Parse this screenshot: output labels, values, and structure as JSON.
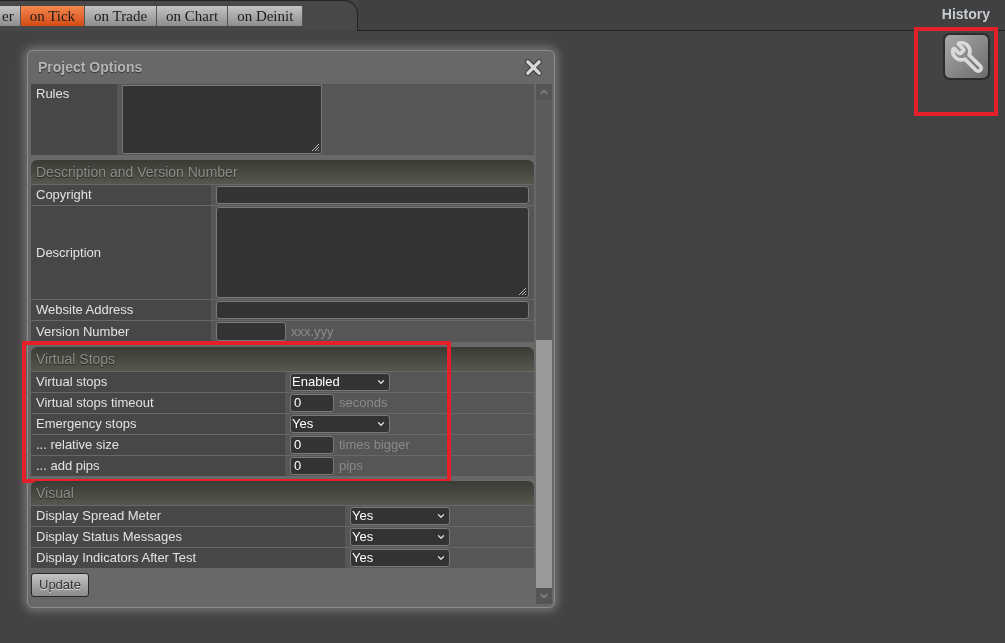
{
  "tabs": [
    {
      "label": "er",
      "selected": false
    },
    {
      "label": "on Tick",
      "selected": true
    },
    {
      "label": "on Trade",
      "selected": false
    },
    {
      "label": "on Chart",
      "selected": false
    },
    {
      "label": "on Deinit",
      "selected": false
    }
  ],
  "history": {
    "label": "History",
    "tool_highlighted": true
  },
  "dialog": {
    "title": "Project Options",
    "sections": [
      {
        "highlighted": false,
        "rows": [
          {
            "label": "Rules",
            "kind": "short_textarea"
          }
        ]
      },
      {
        "title": "Description and Version Number",
        "highlighted": false,
        "rows": [
          {
            "label": "Copyright",
            "kind": "input"
          },
          {
            "label": "Description",
            "kind": "textarea"
          },
          {
            "label": "Website Address",
            "kind": "input"
          },
          {
            "label": "Version Number",
            "kind": "short_input",
            "hint": "xxx.yyy"
          }
        ]
      },
      {
        "title": "Virtual Stops",
        "highlighted": true,
        "rows": [
          {
            "label": "Virtual stops",
            "kind": "select",
            "value": "Enabled"
          },
          {
            "label": "Virtual stops timeout",
            "kind": "number",
            "value": "0",
            "hint": "seconds"
          },
          {
            "label": "Emergency stops",
            "kind": "select",
            "value": "Yes"
          },
          {
            "label": "... relative size",
            "kind": "number",
            "value": "0",
            "hint": "times bigger"
          },
          {
            "label": "... add pips",
            "kind": "number",
            "value": "0",
            "hint": "pips"
          }
        ]
      },
      {
        "title": "Visual",
        "highlighted": false,
        "rows": [
          {
            "label": "Display Spread Meter",
            "kind": "select",
            "value": "Yes"
          },
          {
            "label": "Display Status Messages",
            "kind": "select",
            "value": "Yes"
          },
          {
            "label": "Display Indicators After Test",
            "kind": "select",
            "value": "Yes"
          }
        ]
      }
    ],
    "button": "Update"
  }
}
